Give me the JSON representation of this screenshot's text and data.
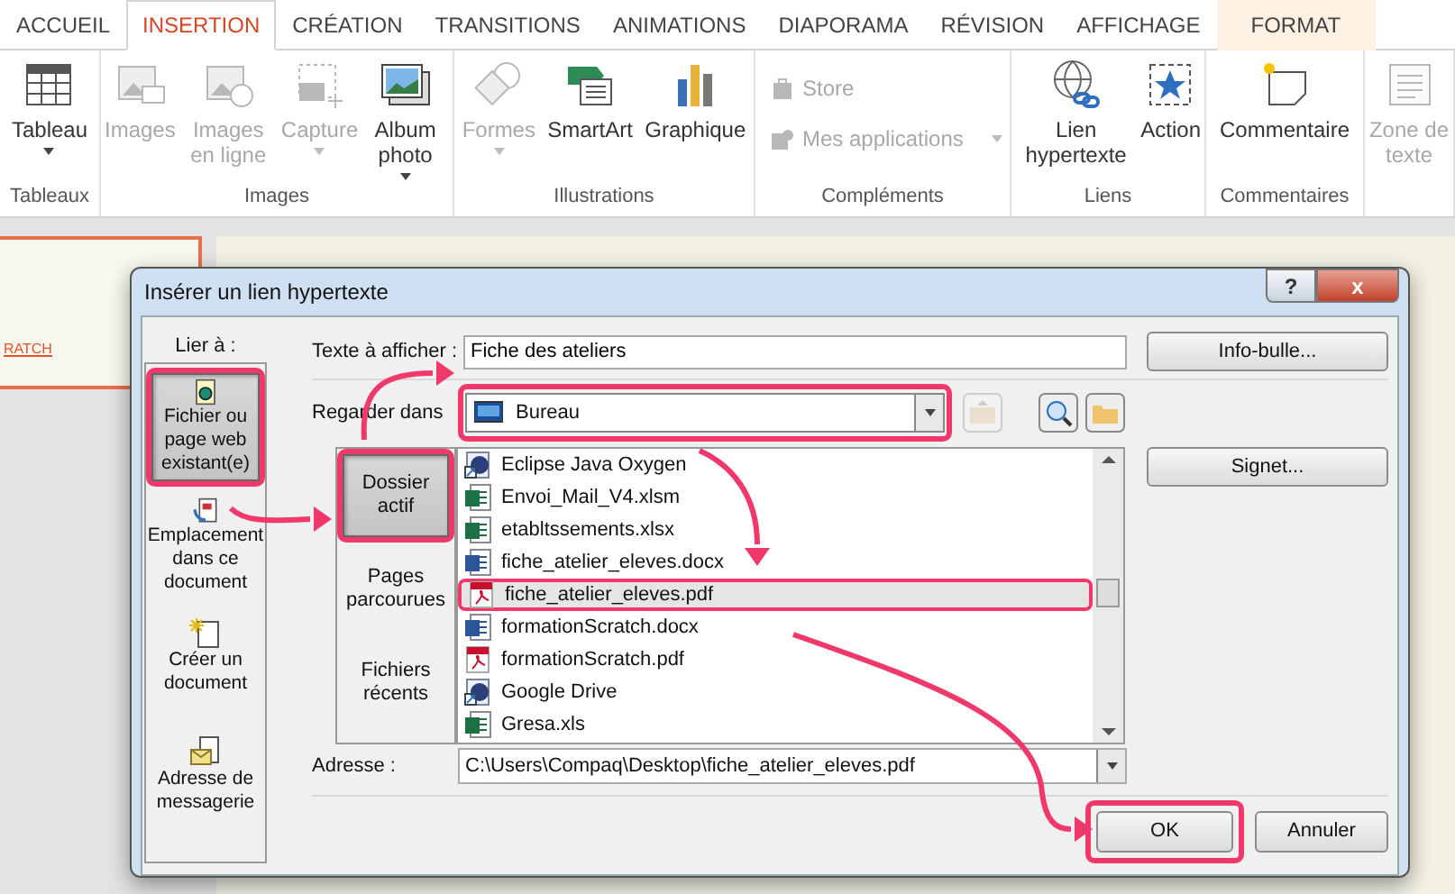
{
  "ribbon": {
    "tabs": [
      {
        "label": "ACCUEIL",
        "selected": false,
        "contextual": false
      },
      {
        "label": "INSERTION",
        "selected": true,
        "contextual": false
      },
      {
        "label": "CRÉATION",
        "selected": false,
        "contextual": false
      },
      {
        "label": "TRANSITIONS",
        "selected": false,
        "contextual": false
      },
      {
        "label": "ANIMATIONS",
        "selected": false,
        "contextual": false
      },
      {
        "label": "DIAPORAMA",
        "selected": false,
        "contextual": false
      },
      {
        "label": "RÉVISION",
        "selected": false,
        "contextual": false
      },
      {
        "label": "AFFICHAGE",
        "selected": false,
        "contextual": false
      },
      {
        "label": "FORMAT",
        "selected": false,
        "contextual": true
      }
    ],
    "groups": [
      {
        "label": "Tableaux",
        "items": [
          {
            "kind": "table",
            "label": "Tableau",
            "disabled": false,
            "dropdown": true
          }
        ]
      },
      {
        "label": "Images",
        "items": [
          {
            "kind": "image",
            "label": "Images",
            "disabled": true,
            "dropdown": false
          },
          {
            "kind": "online-image",
            "label": "Images en ligne",
            "disabled": true,
            "dropdown": false
          },
          {
            "kind": "capture",
            "label": "Capture",
            "disabled": true,
            "dropdown": true
          },
          {
            "kind": "album",
            "label": "Album photo",
            "disabled": false,
            "dropdown": true
          }
        ]
      },
      {
        "label": "Illustrations",
        "items": [
          {
            "kind": "shapes",
            "label": "Formes",
            "disabled": true,
            "dropdown": true
          },
          {
            "kind": "smartart",
            "label": "SmartArt",
            "disabled": false,
            "dropdown": false
          },
          {
            "kind": "chart",
            "label": "Graphique",
            "disabled": false,
            "dropdown": false
          }
        ]
      },
      {
        "label": "Compléments",
        "items": [
          {
            "kind": "store",
            "label": "Store",
            "disabled": true,
            "dropdown": false
          },
          {
            "kind": "apps",
            "label": "Mes applications",
            "disabled": true,
            "dropdown": true
          }
        ]
      },
      {
        "label": "Liens",
        "items": [
          {
            "kind": "link",
            "label": "Lien hypertexte",
            "disabled": false,
            "dropdown": false
          },
          {
            "kind": "action",
            "label": "Action",
            "disabled": false,
            "dropdown": false
          }
        ]
      },
      {
        "label": "Commentaires",
        "items": [
          {
            "kind": "comment",
            "label": "Commentaire",
            "disabled": false,
            "dropdown": false
          }
        ]
      },
      {
        "items": [
          {
            "kind": "textbox",
            "label": "Zone de texte",
            "disabled": true,
            "dropdown": false
          }
        ]
      }
    ]
  },
  "slide_thumbnail": {
    "text": "RATCH"
  },
  "dialog": {
    "title": "Insérer un lien hypertexte",
    "help_button": "?",
    "close_button": "x",
    "link_to_label": "Lier à :",
    "link_targets": [
      {
        "kind": "file",
        "label": "Fichier ou page web existant(e)",
        "selected": true,
        "annotated": true
      },
      {
        "kind": "place",
        "label": "Emplacement dans ce document",
        "selected": false,
        "annotated": false
      },
      {
        "kind": "new",
        "label": "Créer un document",
        "selected": false,
        "annotated": false
      },
      {
        "kind": "mail",
        "label": "Adresse de messagerie",
        "selected": false,
        "annotated": false
      }
    ],
    "text_label": "Texte à afficher :",
    "text_value": "Fiche des ateliers",
    "info_button": "Info-bulle...",
    "look_in_label": "Regarder dans",
    "look_in_value": "Bureau",
    "look_in_annotated": true,
    "browse_targets": [
      {
        "label": "Dossier actif",
        "selected": true,
        "annotated": true
      },
      {
        "label": "Pages parcourues",
        "selected": false,
        "annotated": false
      },
      {
        "label": "Fichiers récents",
        "selected": false,
        "annotated": false
      }
    ],
    "files": [
      {
        "kind": "shortcut",
        "name": "Eclipse Java Oxygen",
        "selected": false,
        "annotated": false
      },
      {
        "kind": "excel",
        "name": "Envoi_Mail_V4.xlsm",
        "selected": false,
        "annotated": false
      },
      {
        "kind": "excel",
        "name": "etabltssements.xlsx",
        "selected": false,
        "annotated": false
      },
      {
        "kind": "word",
        "name": "fiche_atelier_eleves.docx",
        "selected": false,
        "annotated": false
      },
      {
        "kind": "pdf",
        "name": "fiche_atelier_eleves.pdf",
        "selected": true,
        "annotated": true
      },
      {
        "kind": "word",
        "name": "formationScratch.docx",
        "selected": false,
        "annotated": false
      },
      {
        "kind": "pdf",
        "name": "formationScratch.pdf",
        "selected": false,
        "annotated": false
      },
      {
        "kind": "shortcut",
        "name": "Google Drive",
        "selected": false,
        "annotated": false
      },
      {
        "kind": "excel",
        "name": "Gresa.xls",
        "selected": false,
        "annotated": false
      }
    ],
    "bookmark_button": "Signet...",
    "address_label": "Adresse :",
    "address_value": "C:\\Users\\Compaq\\Desktop\\fiche_atelier_eleves.pdf",
    "ok_button": "OK",
    "ok_annotated": true,
    "cancel_button": "Annuler"
  }
}
